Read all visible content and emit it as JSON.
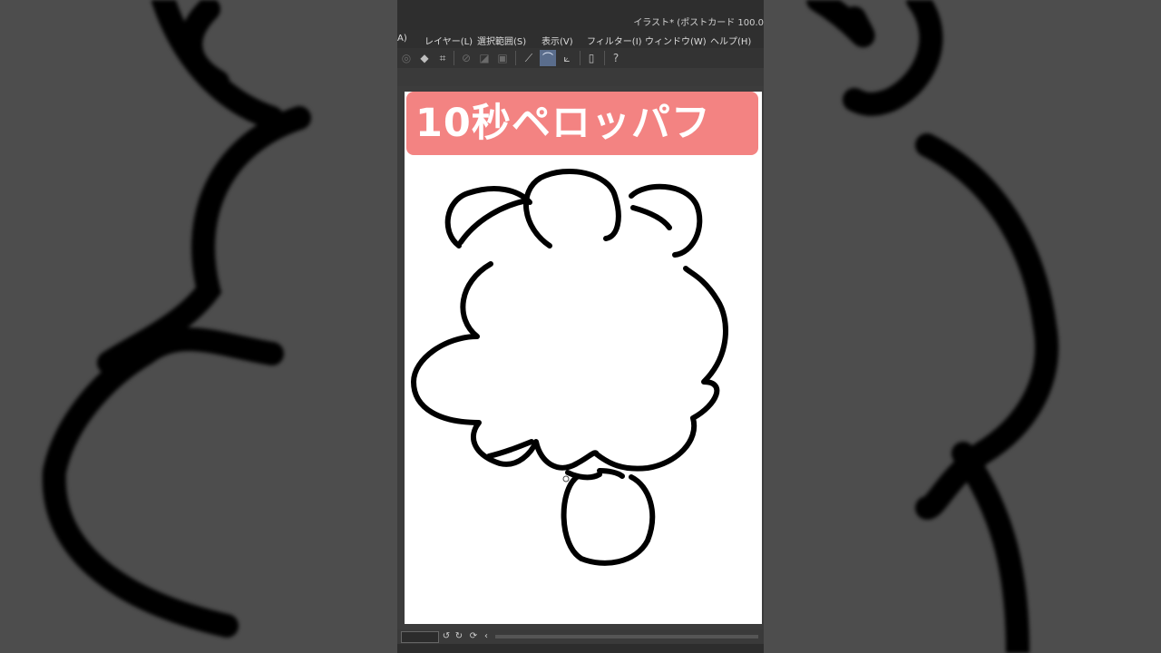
{
  "window": {
    "title": "イラスト* (ポストカード 100.0"
  },
  "menu": {
    "items": [
      {
        "id": "partial",
        "label": "A)"
      },
      {
        "id": "layer",
        "label": "レイヤー(L)"
      },
      {
        "id": "select",
        "label": "選択範囲(S)"
      },
      {
        "id": "view",
        "label": "表示(V)"
      },
      {
        "id": "filter",
        "label": "フィルター(I)"
      },
      {
        "id": "window",
        "label": "ウィンドウ(W)"
      },
      {
        "id": "help",
        "label": "ヘルプ(H)"
      }
    ]
  },
  "toolbar": {
    "icons": [
      "layer-icon",
      "fill-icon",
      "crop-icon",
      "ruler-icon",
      "gradient-icon",
      "frame-icon",
      "stabilizer-icon",
      "brush-curve-icon",
      "vector-line-icon",
      "device-icon",
      "help-icon"
    ],
    "active": "brush-curve-icon"
  },
  "canvas": {
    "banner_text": "10秒ペロッパフ"
  },
  "colors": {
    "banner": "#f38382",
    "canvas": "#ffffff",
    "ink": "#000000",
    "app_bg": "#3c3c3c",
    "active_tool": "#5a6d8c"
  }
}
